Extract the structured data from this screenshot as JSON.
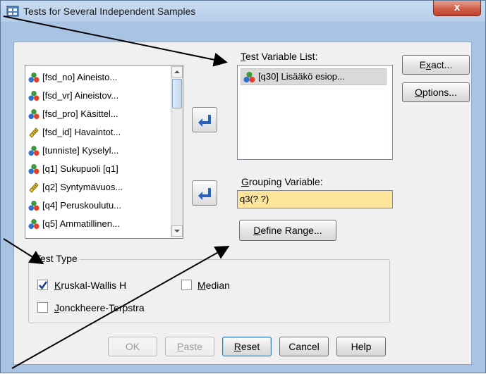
{
  "window": {
    "title": "Tests for Several Independent Samples",
    "close_glyph": "x"
  },
  "variables": [
    {
      "label": "[fsd_no] Aineisto...",
      "type": "nominal"
    },
    {
      "label": "[fsd_vr] Aineistov...",
      "type": "nominal"
    },
    {
      "label": "[fsd_pro] Käsittel...",
      "type": "nominal"
    },
    {
      "label": "[fsd_id] Havaintot...",
      "type": "scale"
    },
    {
      "label": "[tunniste] Kyselyl...",
      "type": "nominal"
    },
    {
      "label": "[q1] Sukupuoli [q1]",
      "type": "nominal"
    },
    {
      "label": "[q2] Syntymävuos...",
      "type": "scale"
    },
    {
      "label": "[q4] Peruskoulutu...",
      "type": "nominal"
    },
    {
      "label": "[q5] Ammatillinen...",
      "type": "nominal"
    }
  ],
  "test_variable": {
    "label_prefix": "",
    "label_mnemonic": "T",
    "label_rest": "est Variable List:",
    "items": [
      "[q30] Lisääkö esiop..."
    ]
  },
  "grouping": {
    "label_mnemonic": "G",
    "label_rest": "rouping Variable:",
    "value": "q3(? ?)"
  },
  "define_range": {
    "mnemonic": "D",
    "rest": "efine Range..."
  },
  "side_buttons": {
    "exact": {
      "pre": "E",
      "mnemonic": "x",
      "post": "act..."
    },
    "options": {
      "pre": "",
      "mnemonic": "O",
      "post": "ptions..."
    }
  },
  "test_type": {
    "title": "Test Type",
    "kruskal": {
      "mnemonic": "K",
      "rest": "ruskal-Wallis H",
      "checked": true
    },
    "median": {
      "mnemonic": "M",
      "rest": "edian",
      "checked": false
    },
    "jonckheere": {
      "mnemonic": "J",
      "rest": "onckheere-Terpstra",
      "checked": false
    }
  },
  "bottom_buttons": {
    "ok": "OK",
    "paste": {
      "mnemonic": "P",
      "rest": "aste"
    },
    "reset": {
      "mnemonic": "R",
      "rest": "eset"
    },
    "cancel": "Cancel",
    "help": "Help"
  },
  "colors": {
    "frame": "#a9c4e3",
    "client": "#f0f0f0",
    "grouping_highlight": "#fde49a",
    "arrow_blue": "#2a62b8"
  }
}
